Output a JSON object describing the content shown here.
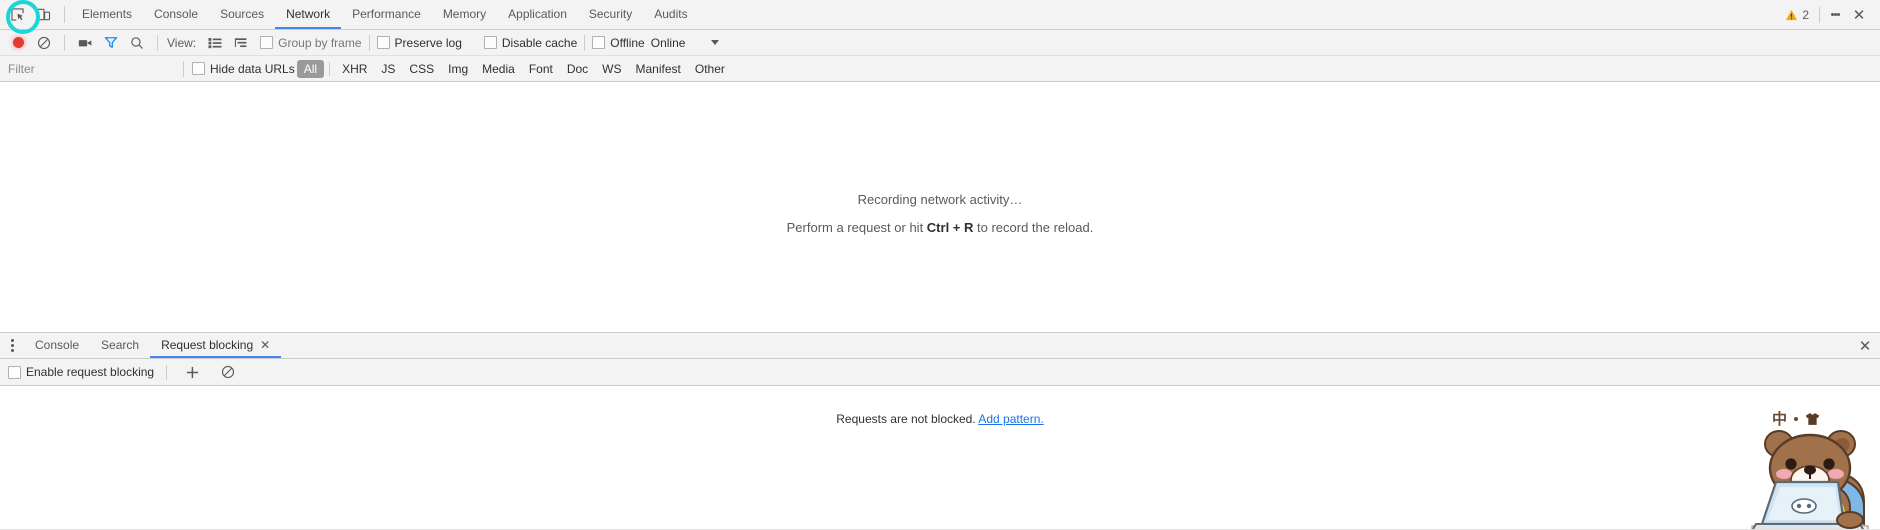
{
  "window": {
    "title": "Chrome DevTools"
  },
  "top_toolbar": {
    "inspect_icon": "inspect-element-icon",
    "device_icon": "device-toolbar-icon",
    "tabs": [
      {
        "label": "Elements",
        "active": false
      },
      {
        "label": "Console",
        "active": false
      },
      {
        "label": "Sources",
        "active": false
      },
      {
        "label": "Network",
        "active": true
      },
      {
        "label": "Performance",
        "active": false
      },
      {
        "label": "Memory",
        "active": false
      },
      {
        "label": "Application",
        "active": false
      },
      {
        "label": "Security",
        "active": false
      },
      {
        "label": "Audits",
        "active": false
      }
    ],
    "warning_count": "2",
    "warning_icon": "warning-triangle-icon",
    "warning_color": "#f5a623",
    "more_icon": "kebab-menu-icon",
    "close_icon": "close-icon",
    "close_glyph": "✕"
  },
  "network_toolbar": {
    "record_icon": "record-button",
    "record_color": "#e53935",
    "clear_icon": "clear-icon",
    "screenshot_icon": "camera-icon",
    "filter_icon": "filter-funnel-icon",
    "filter_icon_color": "#4285f4",
    "search_icon": "search-icon",
    "view_label": "View:",
    "view_list_icon": "list-view-icon",
    "view_waterfall_icon": "waterfall-view-icon",
    "group_by_frame": {
      "label": "Group by frame",
      "checked": false,
      "disabled": true
    },
    "preserve_log": {
      "label": "Preserve log",
      "checked": false
    },
    "disable_cache": {
      "label": "Disable cache",
      "checked": false
    },
    "offline": {
      "label": "Offline",
      "checked": false
    },
    "throttling_value": "Online",
    "throttling_caret": "chevron-down-icon"
  },
  "filter_bar": {
    "filter_placeholder": "Filter",
    "filter_value": "",
    "hide_data_urls": {
      "label": "Hide data URLs",
      "checked": false
    },
    "types": [
      {
        "label": "All",
        "active": true
      },
      {
        "label": "XHR",
        "active": false
      },
      {
        "label": "JS",
        "active": false
      },
      {
        "label": "CSS",
        "active": false
      },
      {
        "label": "Img",
        "active": false
      },
      {
        "label": "Media",
        "active": false
      },
      {
        "label": "Font",
        "active": false
      },
      {
        "label": "Doc",
        "active": false
      },
      {
        "label": "WS",
        "active": false
      },
      {
        "label": "Manifest",
        "active": false
      },
      {
        "label": "Other",
        "active": false
      }
    ]
  },
  "main_panel": {
    "recording_message": "Recording network activity…",
    "hint_prefix": "Perform a request or hit ",
    "hint_shortcut": "Ctrl + R",
    "hint_suffix": " to record the reload."
  },
  "drawer": {
    "menu_icon": "kebab-menu-icon",
    "tabs": [
      {
        "label": "Console",
        "active": false,
        "closable": false
      },
      {
        "label": "Search",
        "active": false,
        "closable": false
      },
      {
        "label": "Request blocking",
        "active": true,
        "closable": true,
        "close_glyph": "✕"
      }
    ],
    "close_icon": "close-icon",
    "close_glyph": "✕",
    "request_blocking": {
      "enable_label": "Enable request blocking",
      "enable_checked": false,
      "add_icon": "plus-icon",
      "add_glyph": "＋",
      "remove_all_icon": "block-all-icon",
      "status_text": "Requests are not blocked. ",
      "status_link": "Add pattern."
    }
  },
  "sticker": {
    "name": "bear-with-laptop-sticker",
    "caption_char": "中",
    "caption_shirt": "shirt-icon"
  },
  "colors": {
    "accent_blue": "#4285f4",
    "link_blue": "#1a73e8",
    "toolbar_bg": "#f3f3f3",
    "border": "#cdcdcd",
    "highlight_ring": "#1ad6d6",
    "pill_active_bg": "#9a9a9a"
  }
}
